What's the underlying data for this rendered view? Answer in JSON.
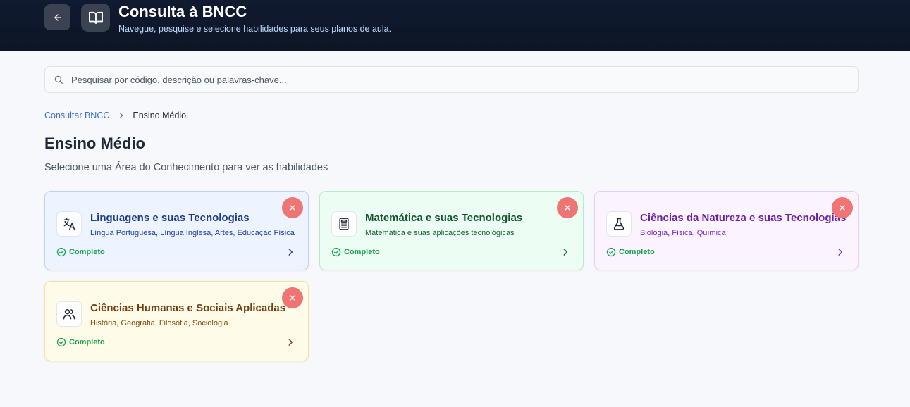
{
  "header": {
    "title": "Consulta à BNCC",
    "subtitle": "Navegue, pesquise e selecione habilidades para seus planos de aula."
  },
  "search": {
    "placeholder": "Pesquisar por código, descrição ou palavras-chave...",
    "value": ""
  },
  "breadcrumb": {
    "root": "Consultar BNCC",
    "current": "Ensino Médio"
  },
  "page": {
    "title": "Ensino Médio",
    "description": "Selecione uma Área do Conhecimento para ver as habilidades"
  },
  "cards": [
    {
      "title": "Linguagens e suas Tecnologias",
      "subtitle": "Língua Portuguesa, Língua Inglesa, Artes, Educação Física",
      "status": "Completo",
      "icon": "translate-icon",
      "color": "#1e3a8a"
    },
    {
      "title": "Matemática e suas Tecnologias",
      "subtitle": "Matemática e suas aplicações tecnológicas",
      "status": "Completo",
      "icon": "calculator-icon",
      "color": "#14532d"
    },
    {
      "title": "Ciências da Natureza e suas Tecnologias",
      "subtitle": "Biologia, Física, Química",
      "status": "Completo",
      "icon": "flask-icon",
      "color": "#6b21a8"
    },
    {
      "title": "Ciências Humanas e Sociais Aplicadas",
      "subtitle": "História, Geografia, Filosofia, Sociologia",
      "status": "Completo",
      "icon": "users-icon",
      "color": "#713f12"
    }
  ],
  "colors": {
    "header_bg": "#101a30",
    "status_green": "#16a34a",
    "close_red": "#ef7474",
    "link_blue": "#3b6fd1"
  }
}
